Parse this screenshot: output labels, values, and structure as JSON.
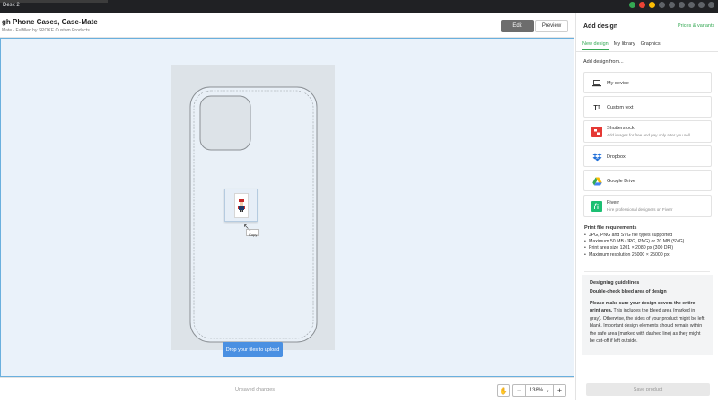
{
  "os": {
    "desk_label": "Desk 2"
  },
  "header": {
    "title": "gh Phone Cases, Case-Mate",
    "subtitle": "Mate · Fulfilled by SPOKE Custom Products",
    "edit_label": "Edit",
    "preview_label": "Preview"
  },
  "canvas": {
    "copy_tooltip": "+ Copy",
    "drop_label": "Drop your files to upload"
  },
  "bottombar": {
    "status": "Unsaved changes",
    "zoom": "138%",
    "zoom_minus": "−",
    "zoom_plus": "+"
  },
  "panel": {
    "title": "Add design",
    "prices_link": "Prices & variants",
    "tabs": [
      "New design",
      "My library",
      "Graphics"
    ],
    "add_from_label": "Add design from...",
    "options": [
      {
        "label": "My device",
        "icon": "laptop-icon"
      },
      {
        "label": "Custom text",
        "icon": "text-icon"
      },
      {
        "label": "Shutterstock",
        "sub": "Add images for free and pay only after you sell",
        "icon": "shutterstock-icon"
      },
      {
        "label": "Dropbox",
        "icon": "dropbox-icon"
      },
      {
        "label": "Google Drive",
        "icon": "google-drive-icon"
      },
      {
        "label": "Fiverr",
        "sub": "Hire professional designers on Fiverr",
        "icon": "fiverr-icon"
      }
    ],
    "requirements": {
      "title": "Print file requirements",
      "items": [
        "JPG, PNG and SVG file types supported",
        "Maximum 50 MB (JPG, PNG) or 20 MB (SVG)",
        "Print area size 1201 × 2080 px (300 DPI)",
        "Maximum resolution 25000 × 25000 px"
      ]
    },
    "guidelines": {
      "title": "Designing guidelines",
      "subtitle": "Double-check bleed area of design",
      "bold_text": "Please make sure your design covers the entire print area.",
      "text": " This includes the bleed area (marked in gray). Otherwise, the sides of your product might be left blank. Important design elements should remain within the safe area (marked with dashed line) as they might be cut-off if left outside."
    },
    "save_label": "Save product"
  },
  "colors": {
    "accent_green": "#34a853",
    "canvas_border": "#6ab0de",
    "drop_button": "#4a90e2",
    "edit_button": "#6d6d6d"
  }
}
